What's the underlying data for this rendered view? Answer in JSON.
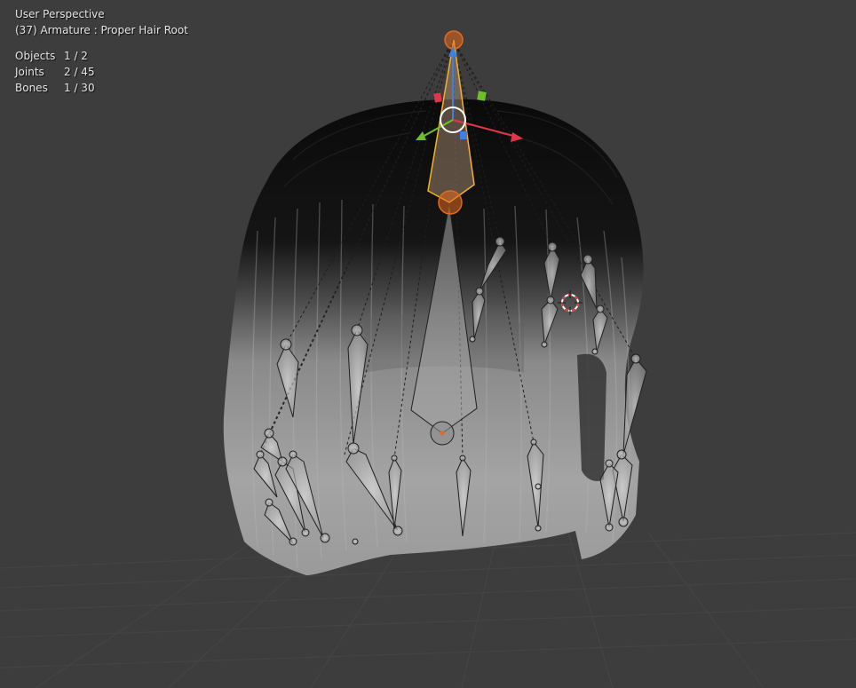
{
  "viewport": {
    "view_name": "User Perspective",
    "context": "(37) Armature : Proper Hair Root",
    "stats": [
      {
        "label": "Objects",
        "value": "1 / 2"
      },
      {
        "label": "Joints",
        "value": "2 / 45"
      },
      {
        "label": "Bones",
        "value": "1 / 30"
      }
    ]
  },
  "colors": {
    "background": "#3d3d3d",
    "selected_bone_outline": "#f2b230",
    "active_joint": "#e36a1f",
    "gizmo_x": "#e0354a",
    "gizmo_y": "#6fbf2b",
    "gizmo_z": "#3f7fe0",
    "cursor_3d": "#e33a3a"
  },
  "icons": [
    "3d-cursor-icon",
    "transform-gizmo-icon"
  ]
}
